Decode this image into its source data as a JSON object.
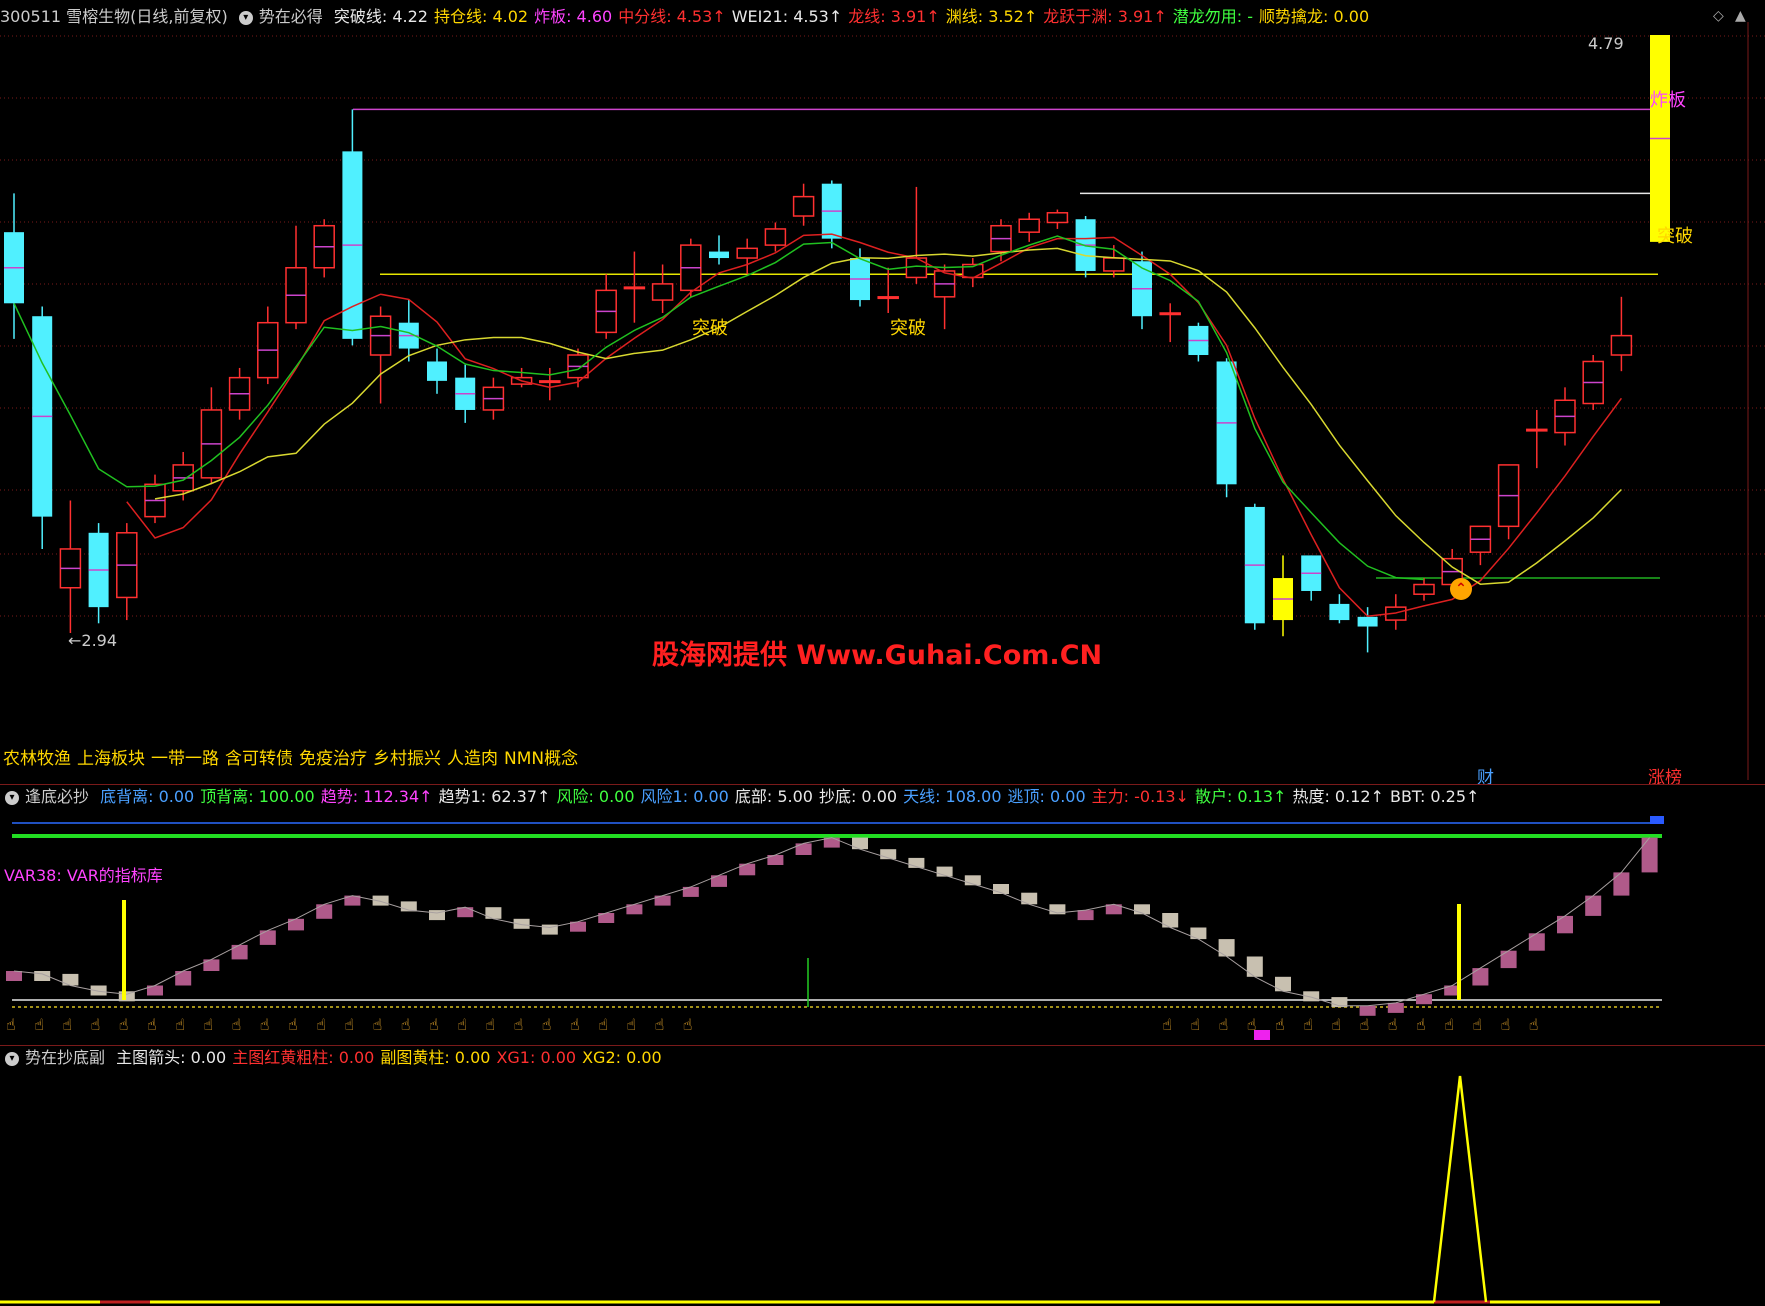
{
  "header": {
    "code_name": "300511 雪榕生物(日线,前复权)",
    "indicator": "势在必得",
    "items": [
      {
        "label": "突破线: 4.22",
        "color": "#e8e8e8"
      },
      {
        "label": "持仓线: 4.02",
        "color": "#ffd700"
      },
      {
        "label": "炸板: 4.60",
        "color": "#ff44ff"
      },
      {
        "label": "中分线: 4.53↑",
        "color": "#ff3030"
      },
      {
        "label": "WEI21: 4.53↑",
        "color": "#e8e8e8"
      },
      {
        "label": "龙线: 3.91↑",
        "color": "#ff3030"
      },
      {
        "label": "渊线: 3.52↑",
        "color": "#ffd700"
      },
      {
        "label": "龙跃于渊: 3.91↑",
        "color": "#ff3030"
      },
      {
        "label": "潜龙勿用: -",
        "color": "#40ff40"
      },
      {
        "label": "顺势擒龙: 0.00",
        "color": "#ffd700"
      }
    ]
  },
  "main_chart": {
    "high_price_label": "4.79",
    "low_price_label": "←2.94",
    "tupo_labels": [
      "突破",
      "突破",
      "突破"
    ],
    "zhaban_label": "炸板"
  },
  "watermark": "股海网提供 Www.Guhai.Com.CN",
  "tags": [
    "农林牧渔",
    "上海板块",
    "一带一路",
    "含可转债",
    "免疫治疗",
    "乡村振兴",
    "人造肉",
    "NMN概念"
  ],
  "badges": {
    "cai": "财",
    "zhangbang": "涨榜"
  },
  "indicator1": {
    "name": "逢底必抄",
    "items": [
      {
        "label": "底背离: 0.00",
        "color": "#4aa0ff"
      },
      {
        "label": "顶背离: 100.00",
        "color": "#40ff40"
      },
      {
        "label": "趋势: 112.34↑",
        "color": "#ff44ff"
      },
      {
        "label": "趋势1: 62.37↑",
        "color": "#e8e8e8"
      },
      {
        "label": "风险: 0.00",
        "color": "#40ff40"
      },
      {
        "label": "风险1: 0.00",
        "color": "#4aa0ff"
      },
      {
        "label": "底部: 5.00",
        "color": "#e8e8e8"
      },
      {
        "label": "抄底: 0.00",
        "color": "#e8e8e8"
      },
      {
        "label": "天线: 108.00",
        "color": "#4aa0ff"
      },
      {
        "label": "逃顶: 0.00",
        "color": "#4aa0ff"
      },
      {
        "label": "主力: -0.13↓",
        "color": "#ff3030"
      },
      {
        "label": "散户: 0.13↑",
        "color": "#40ff40"
      },
      {
        "label": "热度: 0.12↑",
        "color": "#e8e8e8"
      },
      {
        "label": "BBT: 0.25↑",
        "color": "#e8e8e8"
      }
    ],
    "var38": "VAR38: VAR的指标库"
  },
  "indicator2": {
    "name": "势在抄底副",
    "items": [
      {
        "label": "主图箭头: 0.00",
        "color": "#e8e8e8"
      },
      {
        "label": "主图红黄粗柱: 0.00",
        "color": "#ff3030"
      },
      {
        "label": "副图黄柱: 0.00",
        "color": "#ffd700"
      },
      {
        "label": "XG1: 0.00",
        "color": "#ff3030"
      },
      {
        "label": "XG2: 0.00",
        "color": "#ffd700"
      }
    ]
  },
  "candles": [
    {
      "o": 4.18,
      "c": 3.96,
      "h": 4.3,
      "l": 3.85
    },
    {
      "o": 3.92,
      "c": 3.3,
      "h": 3.95,
      "l": 3.2
    },
    {
      "o": 3.08,
      "c": 3.2,
      "h": 3.35,
      "l": 2.94
    },
    {
      "o": 3.25,
      "c": 3.02,
      "h": 3.28,
      "l": 2.97
    },
    {
      "o": 3.05,
      "c": 3.25,
      "h": 3.28,
      "l": 2.98
    },
    {
      "o": 3.3,
      "c": 3.4,
      "h": 3.43,
      "l": 3.28
    },
    {
      "o": 3.38,
      "c": 3.46,
      "h": 3.5,
      "l": 3.35
    },
    {
      "o": 3.42,
      "c": 3.63,
      "h": 3.7,
      "l": 3.4
    },
    {
      "o": 3.63,
      "c": 3.73,
      "h": 3.76,
      "l": 3.6
    },
    {
      "o": 3.73,
      "c": 3.9,
      "h": 3.95,
      "l": 3.71
    },
    {
      "o": 3.9,
      "c": 4.07,
      "h": 4.2,
      "l": 3.88
    },
    {
      "o": 4.07,
      "c": 4.2,
      "h": 4.22,
      "l": 4.04
    },
    {
      "o": 4.43,
      "c": 3.85,
      "h": 4.56,
      "l": 3.83
    },
    {
      "o": 3.8,
      "c": 3.92,
      "h": 3.95,
      "l": 3.65
    },
    {
      "o": 3.9,
      "c": 3.82,
      "h": 3.97,
      "l": 3.78
    },
    {
      "o": 3.78,
      "c": 3.72,
      "h": 3.82,
      "l": 3.68
    },
    {
      "o": 3.73,
      "c": 3.63,
      "h": 3.77,
      "l": 3.59
    },
    {
      "o": 3.63,
      "c": 3.7,
      "h": 3.73,
      "l": 3.6
    },
    {
      "o": 3.71,
      "c": 3.73,
      "h": 3.76,
      "l": 3.7
    },
    {
      "o": 3.72,
      "c": 3.72,
      "h": 3.76,
      "l": 3.66
    },
    {
      "o": 3.73,
      "c": 3.8,
      "h": 3.82,
      "l": 3.7
    },
    {
      "o": 3.87,
      "c": 4.0,
      "h": 4.05,
      "l": 3.85
    },
    {
      "o": 4.01,
      "c": 4.01,
      "h": 4.12,
      "l": 3.9
    },
    {
      "o": 3.97,
      "c": 4.02,
      "h": 4.08,
      "l": 3.93
    },
    {
      "o": 4.0,
      "c": 4.14,
      "h": 4.16,
      "l": 3.98
    },
    {
      "o": 4.12,
      "c": 4.1,
      "h": 4.17,
      "l": 4.08
    },
    {
      "o": 4.1,
      "c": 4.13,
      "h": 4.16,
      "l": 4.05
    },
    {
      "o": 4.14,
      "c": 4.19,
      "h": 4.21,
      "l": 4.12
    },
    {
      "o": 4.23,
      "c": 4.29,
      "h": 4.33,
      "l": 4.2
    },
    {
      "o": 4.33,
      "c": 4.16,
      "h": 4.34,
      "l": 4.13
    },
    {
      "o": 4.1,
      "c": 3.97,
      "h": 4.13,
      "l": 3.95
    },
    {
      "o": 3.98,
      "c": 3.98,
      "h": 4.07,
      "l": 3.93
    },
    {
      "o": 4.04,
      "c": 4.1,
      "h": 4.32,
      "l": 4.02
    },
    {
      "o": 3.98,
      "c": 4.06,
      "h": 4.08,
      "l": 3.88
    },
    {
      "o": 4.04,
      "c": 4.08,
      "h": 4.1,
      "l": 4.01
    },
    {
      "o": 4.12,
      "c": 4.2,
      "h": 4.22,
      "l": 4.09
    },
    {
      "o": 4.18,
      "c": 4.22,
      "h": 4.24,
      "l": 4.15
    },
    {
      "o": 4.21,
      "c": 4.24,
      "h": 4.25,
      "l": 4.19
    },
    {
      "o": 4.22,
      "c": 4.06,
      "h": 4.23,
      "l": 4.04
    },
    {
      "o": 4.06,
      "c": 4.1,
      "h": 4.14,
      "l": 4.04
    },
    {
      "o": 4.09,
      "c": 3.92,
      "h": 4.12,
      "l": 3.88
    },
    {
      "o": 3.93,
      "c": 3.93,
      "h": 3.96,
      "l": 3.84
    },
    {
      "o": 3.89,
      "c": 3.8,
      "h": 3.9,
      "l": 3.78
    },
    {
      "o": 3.78,
      "c": 3.4,
      "h": 3.79,
      "l": 3.36
    },
    {
      "o": 3.33,
      "c": 2.97,
      "h": 3.34,
      "l": 2.95
    },
    {
      "o": 3.11,
      "c": 2.98,
      "h": 3.18,
      "l": 2.93
    },
    {
      "o": 3.18,
      "c": 3.07,
      "h": 3.18,
      "l": 3.04
    },
    {
      "o": 3.03,
      "c": 2.98,
      "h": 3.06,
      "l": 2.97
    },
    {
      "o": 2.99,
      "c": 2.96,
      "h": 3.02,
      "l": 2.88
    },
    {
      "o": 2.98,
      "c": 3.02,
      "h": 3.06,
      "l": 2.95
    },
    {
      "o": 3.06,
      "c": 3.09,
      "h": 3.11,
      "l": 3.04
    },
    {
      "o": 3.09,
      "c": 3.17,
      "h": 3.2,
      "l": 3.06
    },
    {
      "o": 3.19,
      "c": 3.27,
      "h": 3.27,
      "l": 3.15
    },
    {
      "o": 3.27,
      "c": 3.46,
      "h": 3.46,
      "l": 3.23
    },
    {
      "o": 3.57,
      "c": 3.57,
      "h": 3.63,
      "l": 3.45
    },
    {
      "o": 3.56,
      "c": 3.66,
      "h": 3.7,
      "l": 3.52
    },
    {
      "o": 3.65,
      "c": 3.78,
      "h": 3.8,
      "l": 3.63
    },
    {
      "o": 3.8,
      "c": 3.86,
      "h": 3.98,
      "l": 3.75
    }
  ],
  "limit_candle": {
    "o": 4.15,
    "c": 4.79,
    "h": 4.79,
    "l": 4.15
  }
}
